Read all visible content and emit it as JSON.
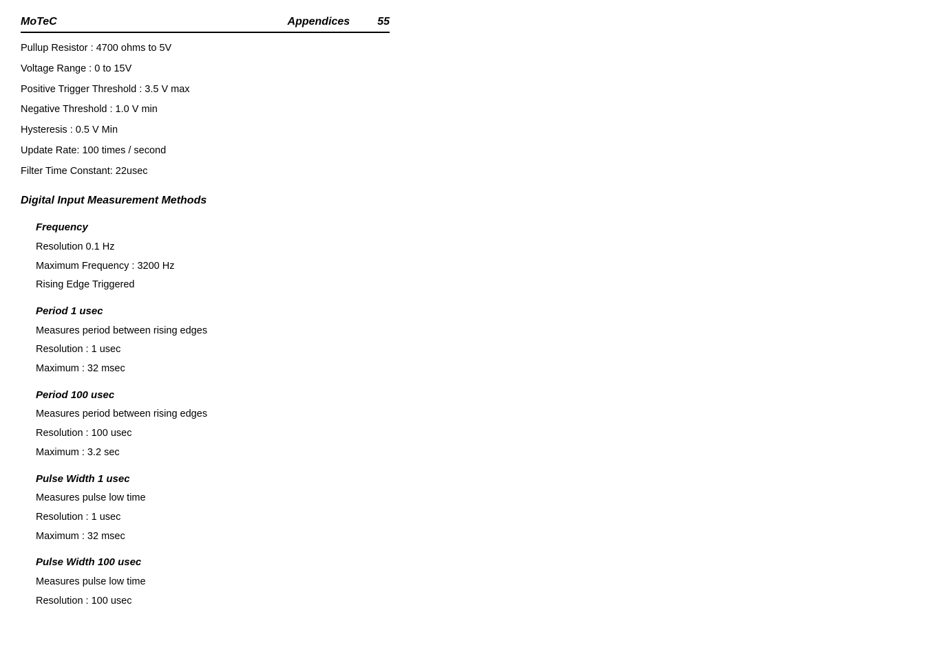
{
  "header": {
    "brand": "MoTeC",
    "title": "Appendices",
    "page": "55"
  },
  "specs": [
    "Pullup Resistor : 4700 ohms to 5V",
    "Voltage Range : 0 to 15V",
    "Positive Trigger Threshold : 3.5 V max",
    "Negative Threshold : 1.0 V min",
    "Hysteresis : 0.5 V Min",
    "Update Rate: 100 times / second",
    "Filter Time Constant: 22usec"
  ],
  "section_title": "Digital Input Measurement Methods",
  "subsections": [
    {
      "title": "Frequency",
      "lines": [
        "Resolution 0.1 Hz",
        "Maximum Frequency : 3200 Hz",
        "Rising Edge Triggered"
      ]
    },
    {
      "title": "Period 1 usec",
      "lines": [
        "Measures period between rising edges",
        "Resolution : 1 usec",
        "Maximum : 32 msec"
      ]
    },
    {
      "title": "Period 100 usec",
      "lines": [
        "Measures period between rising edges",
        "Resolution : 100 usec",
        "Maximum : 3.2 sec"
      ]
    },
    {
      "title": "Pulse Width 1 usec",
      "lines": [
        "Measures pulse low time",
        "Resolution : 1 usec",
        "Maximum : 32 msec"
      ]
    },
    {
      "title": "Pulse Width 100 usec",
      "lines": [
        "Measures pulse low time",
        "Resolution : 100 usec"
      ]
    }
  ]
}
